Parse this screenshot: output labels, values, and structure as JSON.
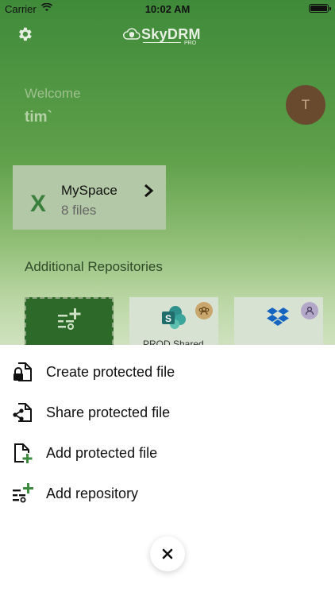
{
  "status_bar": {
    "carrier": "Carrier",
    "time": "10:02 AM"
  },
  "header": {
    "logo_text": "SkyDRM",
    "logo_sub": "PRO"
  },
  "welcome": {
    "greeting": "Welcome",
    "username": "tim`",
    "avatar_initial": "T"
  },
  "myspace": {
    "title": "MySpace",
    "file_count": "8 files",
    "icon": "excel-x-icon"
  },
  "additional_repositories": {
    "label": "Additional Repositories",
    "tiles": [
      {
        "icon": "add-repository-icon"
      },
      {
        "icon": "sharepoint-icon",
        "caption": "PROD Shared"
      },
      {
        "icon": "dropbox-icon"
      }
    ]
  },
  "action_sheet": {
    "items": [
      {
        "label": "Create protected file",
        "icon": "lock-file-icon"
      },
      {
        "label": "Share protected file",
        "icon": "share-file-icon"
      },
      {
        "label": "Add protected file",
        "icon": "add-file-icon"
      },
      {
        "label": "Add repository",
        "icon": "add-repository-icon"
      }
    ],
    "close_icon": "close-icon"
  },
  "colors": {
    "accent_green": "#3b8a3e",
    "brand_green": "#3f8a3a"
  }
}
